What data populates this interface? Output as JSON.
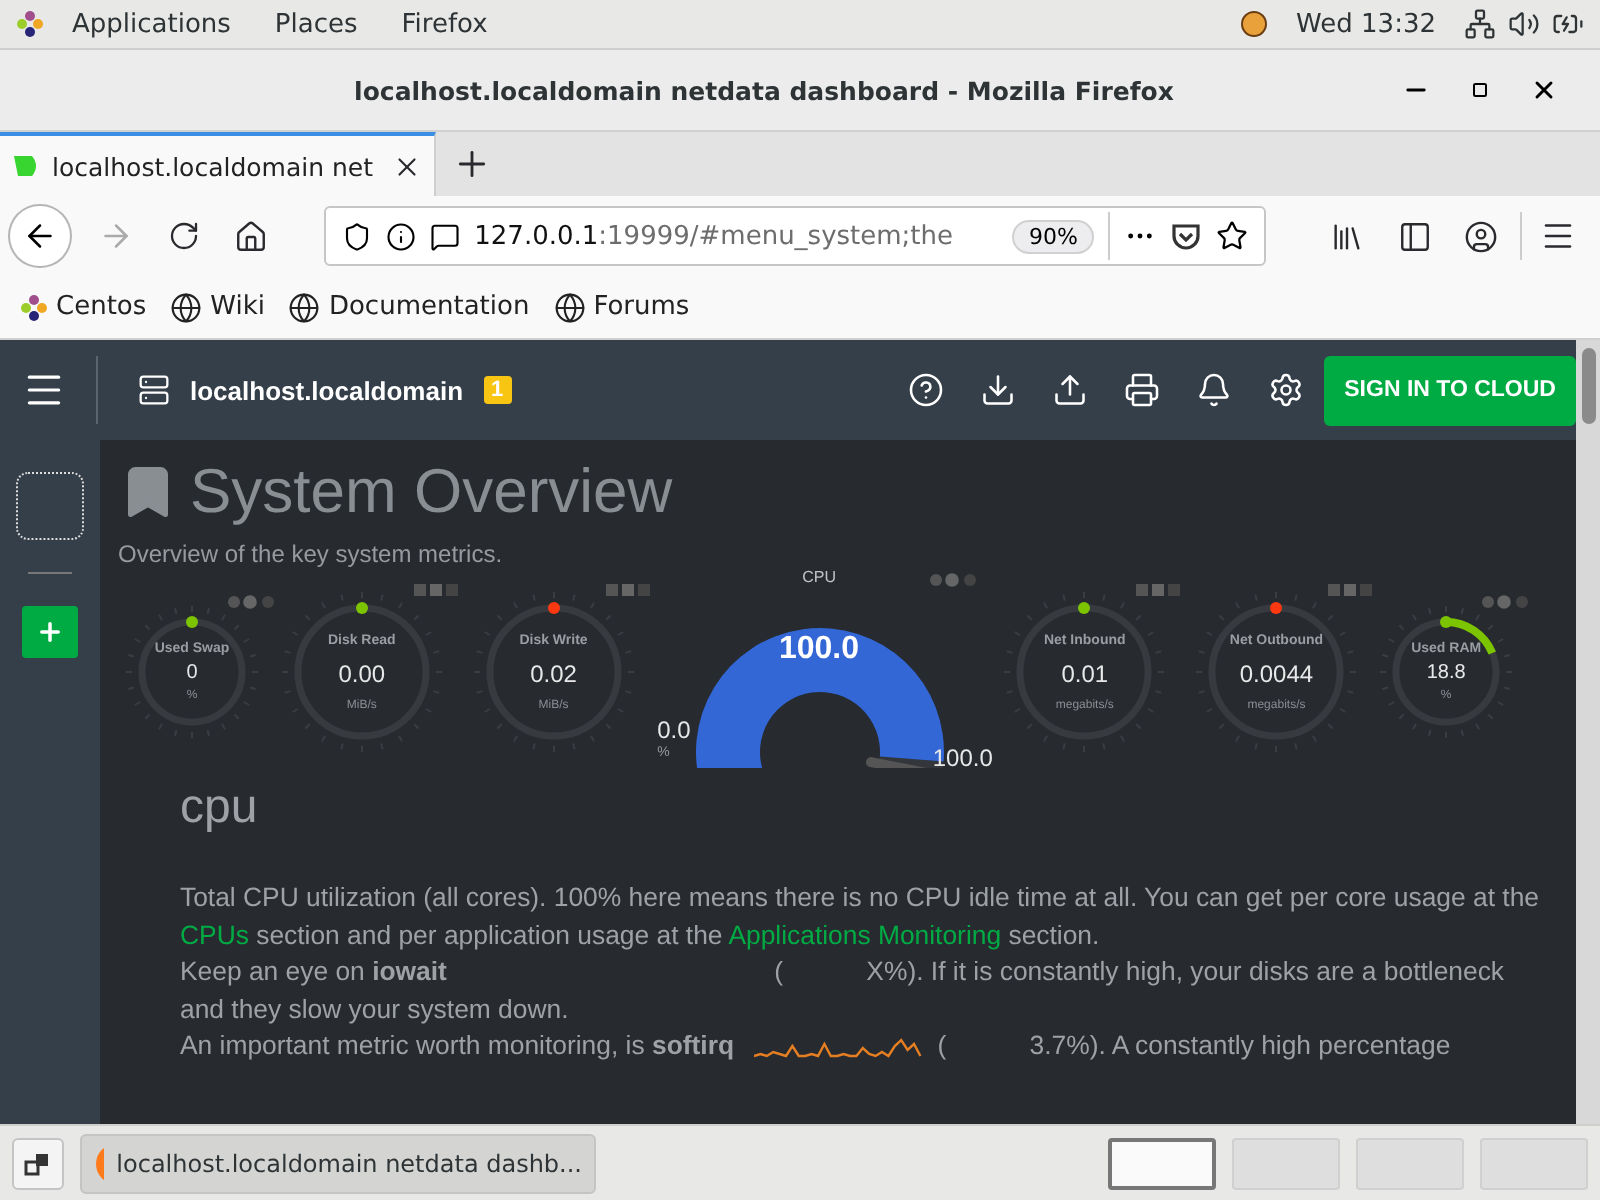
{
  "top_bar": {
    "menus": [
      "Applications",
      "Places",
      "Firefox"
    ],
    "clock": "Wed 13:32"
  },
  "window": {
    "title": "localhost.localdomain netdata dashboard - Mozilla Firefox"
  },
  "tabs": [
    {
      "label": "localhost.localdomain net",
      "selected": true
    }
  ],
  "url_bar": {
    "host": "127.0.0.1",
    "rest": ":19999/#menu_system;the",
    "zoom": "90%"
  },
  "bookmarks": [
    {
      "label": "Centos",
      "kind": "centos"
    },
    {
      "label": "Wiki",
      "kind": "globe"
    },
    {
      "label": "Documentation",
      "kind": "globe"
    },
    {
      "label": "Forums",
      "kind": "globe"
    }
  ],
  "dashboard": {
    "host": "localhost.localdomain",
    "alerts_badge": "1",
    "sign_in": "SIGN IN TO CLOUD",
    "heading": "System Overview",
    "subtitle": "Overview of the key system metrics.",
    "gauges": [
      {
        "kind": "smallpie",
        "title": "Used Swap",
        "value": "0",
        "unit": "%",
        "color": "#7cc300"
      },
      {
        "kind": "pie",
        "title": "Disk Read",
        "value": "0.00",
        "unit": "MiB/s",
        "color": "#7cc300"
      },
      {
        "kind": "pie",
        "title": "Disk Write",
        "value": "0.02",
        "unit": "MiB/s",
        "color": "#fe3912"
      },
      {
        "kind": "gauge",
        "title": "CPU",
        "value": "100.0",
        "min": "0.0",
        "max": "100.0",
        "unit": "%",
        "color": "#3367d6"
      },
      {
        "kind": "pie",
        "title": "Net Inbound",
        "value": "0.01",
        "unit": "megabits/s",
        "color": "#7cc300"
      },
      {
        "kind": "pie",
        "title": "Net Outbound",
        "value": "0.0044",
        "unit": "megabits/s",
        "color": "#fe3912"
      },
      {
        "kind": "smallpie",
        "title": "Used RAM",
        "value": "18.8",
        "unit": "%",
        "color": "#7cc300"
      }
    ],
    "section": "cpu",
    "paragraphs": [
      [
        {
          "kind": "text",
          "text": "Total CPU utilization (all cores). 100% here means there is no CPU idle time at all. You can get per core usage at the"
        },
        {
          "kind": "link",
          "text": "CPUs"
        },
        {
          "kind": "text",
          "text": "section and per application usage at the"
        },
        {
          "kind": "link",
          "text": "Applications Monitoring"
        },
        {
          "kind": "text",
          "text": "section."
        }
      ],
      [
        {
          "kind": "text",
          "text": "Keep an eye on **iowait**"
        },
        {
          "kind": "blank"
        },
        {
          "kind": "text",
          "text": "("
        },
        {
          "kind": "gap"
        },
        {
          "kind": "text",
          "text": "X%). If it is constantly high, your disks are a bottleneck and they slow your system down."
        }
      ],
      [
        {
          "kind": "text",
          "text": "An important metric worth monitoring, is **softirq**"
        },
        {
          "kind": "spark",
          "color": "#e67e22"
        },
        {
          "kind": "text",
          "text": "("
        },
        {
          "kind": "gap"
        },
        {
          "kind": "text",
          "text": "3.7%). A constantly high percentage"
        }
      ]
    ]
  },
  "taskbar": {
    "tasks": [
      {
        "label": "localhost.localdomain netdata dashb...",
        "selected": true
      }
    ],
    "workspaces": [
      {
        "selected": true
      },
      {
        "selected": false
      },
      {
        "selected": false
      },
      {
        "selected": false
      }
    ]
  }
}
